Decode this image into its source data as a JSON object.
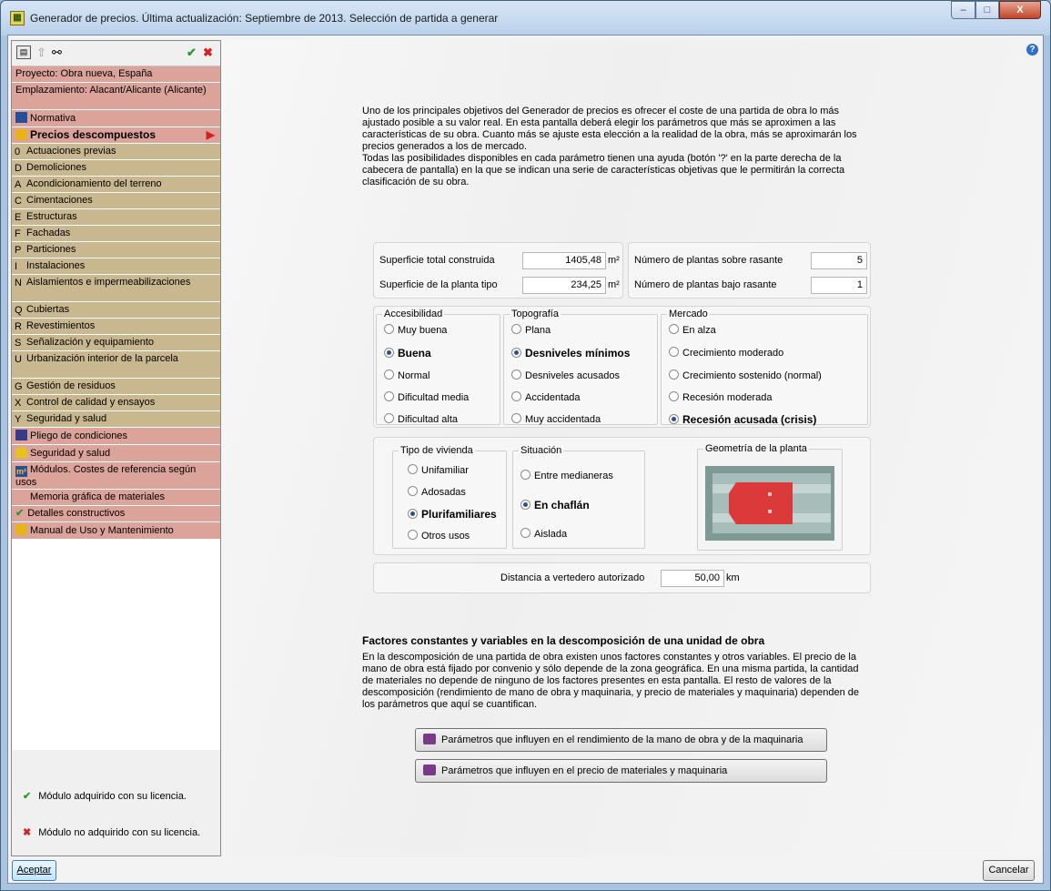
{
  "window": {
    "title": "Generador de precios. Última actualización: Septiembre de 2013. Selección de partida a generar",
    "minimize": "–",
    "maximize": "□",
    "close": "X"
  },
  "sidebar": {
    "items": [
      {
        "code": "",
        "label": "Proyecto: Obra nueva, España"
      },
      {
        "code": "",
        "label": "Emplazamiento: Alacant/Alicante (Alicante)"
      },
      {
        "code": "",
        "label": "Normativa"
      },
      {
        "code": "",
        "label": "Precios descompuestos"
      },
      {
        "code": "0",
        "label": "Actuaciones previas"
      },
      {
        "code": "D",
        "label": "Demoliciones"
      },
      {
        "code": "A",
        "label": "Acondicionamiento del terreno"
      },
      {
        "code": "C",
        "label": "Cimentaciones"
      },
      {
        "code": "E",
        "label": "Estructuras"
      },
      {
        "code": "F",
        "label": "Fachadas"
      },
      {
        "code": "P",
        "label": "Particiones"
      },
      {
        "code": "I",
        "label": "Instalaciones"
      },
      {
        "code": "N",
        "label": "Aislamientos e impermeabilizaciones"
      },
      {
        "code": "Q",
        "label": "Cubiertas"
      },
      {
        "code": "R",
        "label": "Revestimientos"
      },
      {
        "code": "S",
        "label": "Señalización y equipamiento"
      },
      {
        "code": "U",
        "label": "Urbanización interior de la parcela"
      },
      {
        "code": "G",
        "label": "Gestión de residuos"
      },
      {
        "code": "X",
        "label": "Control de calidad y ensayos"
      },
      {
        "code": "Y",
        "label": "Seguridad y salud"
      },
      {
        "code": "",
        "label": "Pliego de condiciones"
      },
      {
        "code": "",
        "label": "Seguridad y salud"
      },
      {
        "code": "",
        "label": "Módulos. Costes de referencia según usos"
      },
      {
        "code": "",
        "label": "Memoria gráfica de materiales"
      },
      {
        "code": "",
        "label": "Detalles constructivos"
      },
      {
        "code": "",
        "label": "Manual de Uso y Mantenimiento"
      }
    ],
    "legend": {
      "acquired": "Módulo adquirido con su licencia.",
      "not_acquired": "Módulo no adquirido con su licencia."
    }
  },
  "intro": {
    "p1": "Uno de los principales objetivos del Generador de precios es ofrecer el coste de una partida de obra lo más ajustado posible a su valor real. En esta pantalla deberá elegir los parámetros que más se aproximen a las características de su obra. Cuanto más se ajuste esta elección a la realidad de la obra, más se aproximarán los precios generados a los de mercado.",
    "p2": "Todas las posibilidades disponibles en cada parámetro tienen una ayuda (botón '?' en la parte derecha de la cabecera de pantalla) en la que se indican una serie de características objetivas que le permitirán la correcta clasificación de su obra."
  },
  "fields": {
    "superficie_total_label": "Superficie total construida",
    "superficie_total_value": "1405,48",
    "superficie_tipo_label": "Superficie de la planta tipo",
    "superficie_tipo_value": "234,25",
    "unit_m2": "m²",
    "plantas_sobre_label": "Número de plantas sobre rasante",
    "plantas_sobre_value": "5",
    "plantas_bajo_label": "Número de plantas bajo rasante",
    "plantas_bajo_value": "1",
    "distancia_label": "Distancia a vertedero autorizado",
    "distancia_value": "50,00",
    "unit_km": "km"
  },
  "accesibilidad": {
    "title": "Accesibilidad",
    "options": [
      "Muy buena",
      "Buena",
      "Normal",
      "Dificultad media",
      "Dificultad alta"
    ],
    "selected": "Buena"
  },
  "topografia": {
    "title": "Topografía",
    "options": [
      "Plana",
      "Desniveles mínimos",
      "Desniveles acusados",
      "Accidentada",
      "Muy accidentada"
    ],
    "selected": "Desniveles mínimos"
  },
  "mercado": {
    "title": "Mercado",
    "options": [
      "En alza",
      "Crecimiento moderado",
      "Crecimiento sostenido (normal)",
      "Recesión moderada",
      "Recesión acusada (crisis)"
    ],
    "selected": "Recesión acusada (crisis)"
  },
  "tipo_vivienda": {
    "title": "Tipo de vivienda",
    "options": [
      "Unifamiliar",
      "Adosadas",
      "Plurifamiliares",
      "Otros usos"
    ],
    "selected": "Plurifamiliares"
  },
  "situacion": {
    "title": "Situación",
    "options": [
      "Entre medianeras",
      "En chaflán",
      "Aislada"
    ],
    "selected": "En chaflán"
  },
  "geometria": {
    "title": "Geometría de la planta"
  },
  "factores": {
    "heading": "Factores constantes y variables en la descomposición de una unidad de obra",
    "text": "En la descomposición de una partida de obra existen unos factores constantes y otros variables. El precio de la mano de obra está fijado por convenio y sólo depende de la zona geográfica. En una misma partida, la cantidad de materiales no depende de ninguno de los factores presentes en esta pantalla. El resto de valores de la descomposición (rendimiento de mano de obra y maquinaria, y precio de materiales y maquinaria) dependen de los parámetros que aquí se cuantifican.",
    "btn1": "Parámetros que influyen en el rendimiento de la mano de obra y de la maquinaria",
    "btn2": "Parámetros que influyen en el precio de materiales y maquinaria"
  },
  "footer": {
    "accept": "Aceptar",
    "cancel": "Cancelar"
  },
  "colors": {
    "menu_main": "#dba39a",
    "menu_sub": "#c9b88f",
    "accent": "#2a4f9a"
  }
}
